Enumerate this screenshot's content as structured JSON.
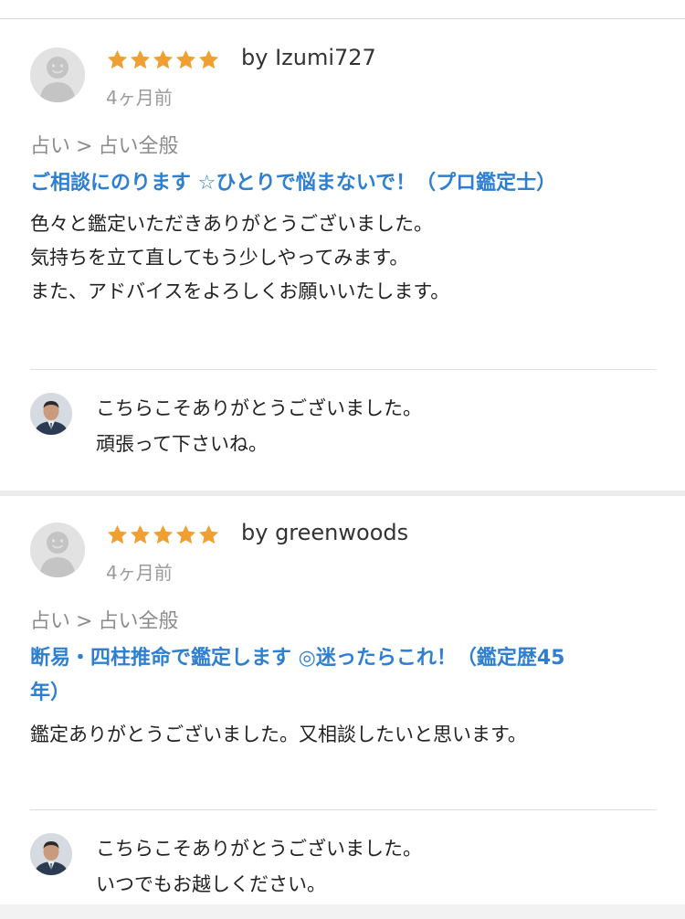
{
  "reviews": [
    {
      "rating": 5,
      "byline": "by Izumi727",
      "time": "4ヶ月前",
      "breadcrumb": [
        "占い",
        "占い全般"
      ],
      "breadcrumb_sep": ">",
      "service_title": "ご相談にのります ☆ひとりで悩まないで！（プロ鑑定士）",
      "comment_lines": [
        "色々と鑑定いただきありがとうございました。",
        "気持ちを立て直してもう少しやってみます。",
        "また、アドバイスをよろしくお願いいたします。"
      ],
      "reply_lines": [
        "こちらこそありがとうございました。",
        "頑張って下さいね。"
      ]
    },
    {
      "rating": 5,
      "byline": "by greenwoods",
      "time": "4ヶ月前",
      "breadcrumb": [
        "占い",
        "占い全般"
      ],
      "breadcrumb_sep": ">",
      "service_title_lines": [
        "断易・四柱推命で鑑定します ◎迷ったらこれ！（鑑定歴45",
        "年）"
      ],
      "comment_lines": [
        "鑑定ありがとうございました。又相談したいと思います。"
      ],
      "reply_lines": [
        "こちらこそありがとうございました。",
        "いつでもお越しください。"
      ]
    }
  ],
  "colors": {
    "star": "#f0a030",
    "title_link": "#2f7fd1",
    "muted": "#9a9a9a"
  },
  "icons": {
    "avatar": "default-user-icon",
    "star": "star-icon",
    "seller_avatar": "seller-photo"
  }
}
